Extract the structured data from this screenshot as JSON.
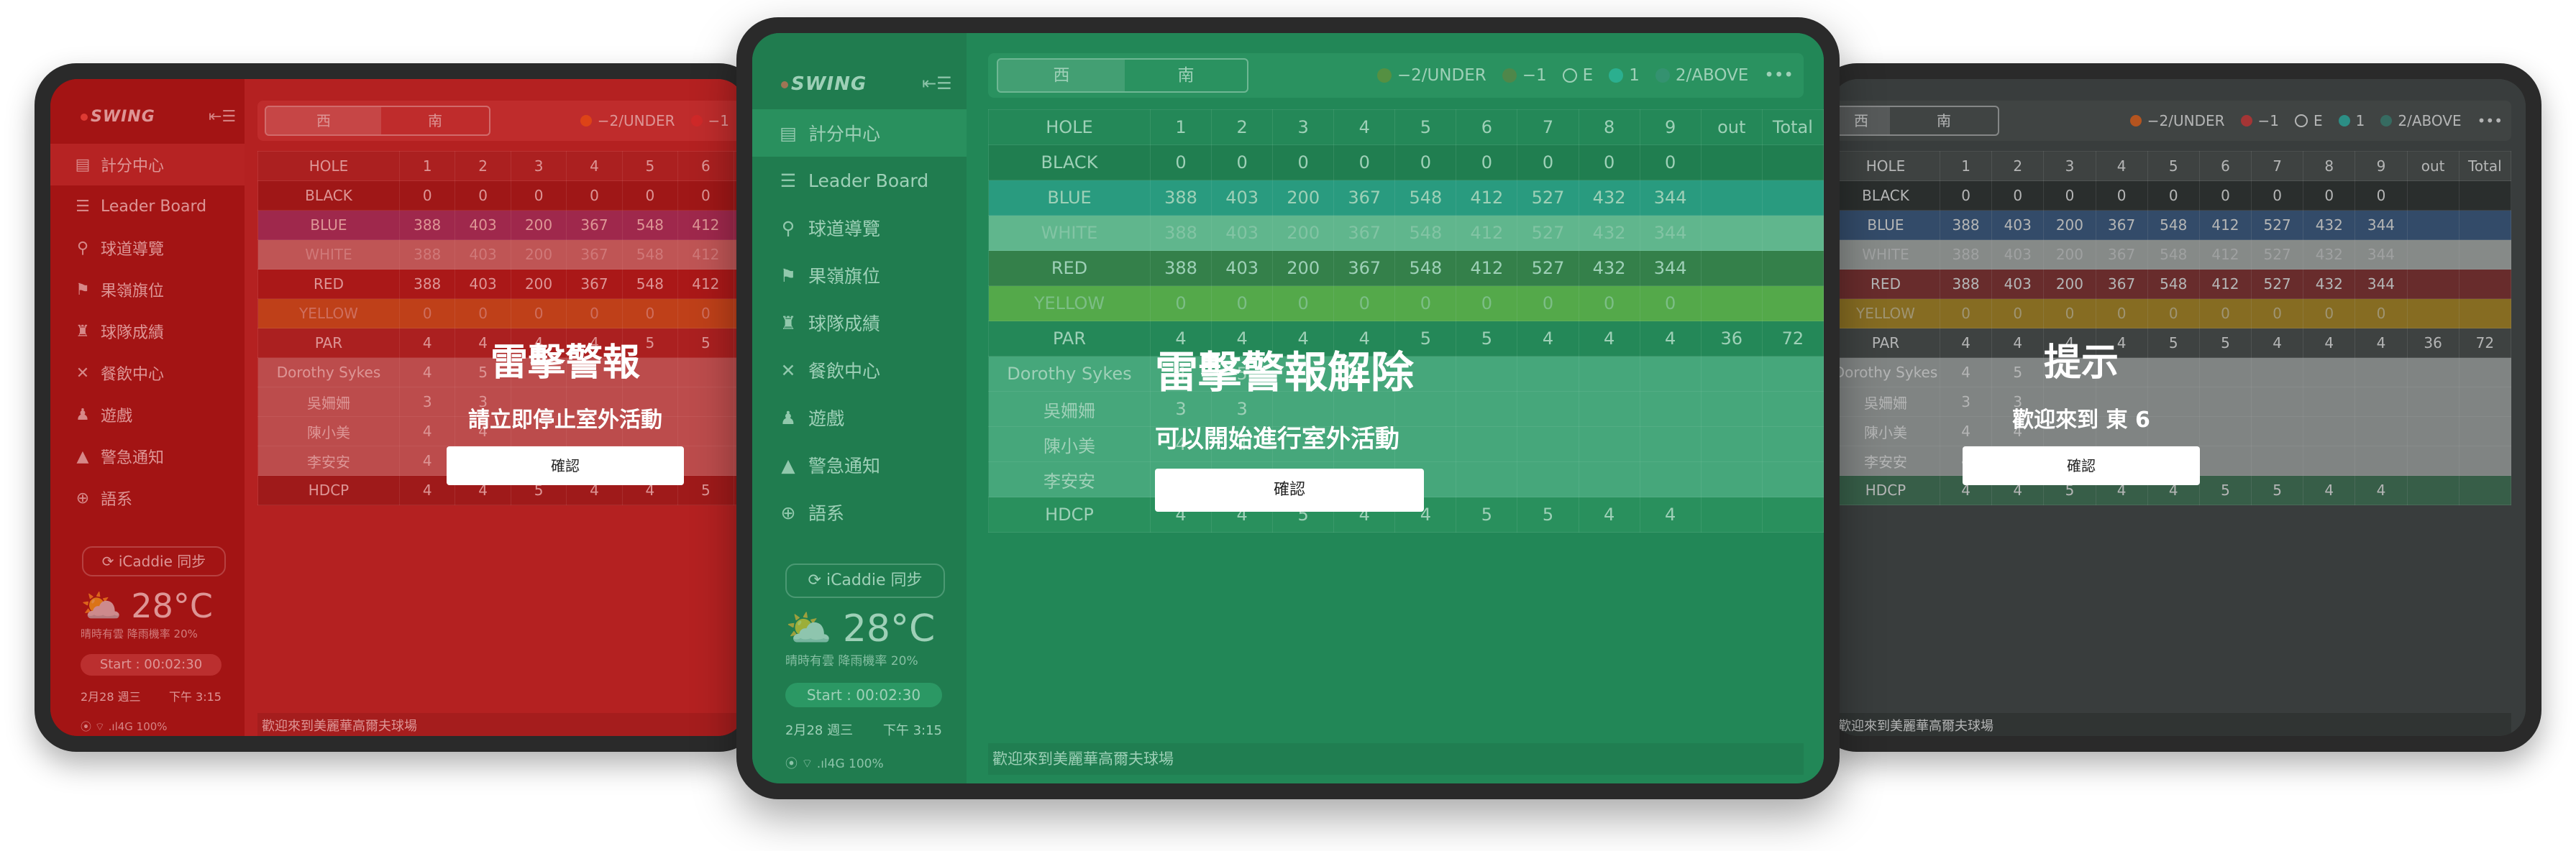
{
  "common": {
    "logo": "SWING",
    "menu": [
      "計分中心",
      "Leader Board",
      "球道導覽",
      "果嶺旗位",
      "球隊成績",
      "餐飲中心",
      "遊戲",
      "警急通知",
      "語系"
    ],
    "icaddie": "iCaddie 同步",
    "temp": "28°C",
    "weather_sub": "晴時有雲  降雨機率 20%",
    "start": "Start : 00:02:30",
    "date": "2月28 週三",
    "time": "下午 3:15",
    "status": "⦿  ⌔ .ıl4G   100%",
    "tabs": [
      "西",
      "南"
    ],
    "legend": [
      "−2/UNDER",
      "−1",
      "E",
      "1",
      "2/ABOVE"
    ],
    "more": "•••",
    "ticker": "歡迎來到美麗華高爾夫球場",
    "header": [
      "HOLE",
      "1",
      "2",
      "3",
      "4",
      "5",
      "6",
      "7",
      "8",
      "9",
      "out",
      "Total"
    ],
    "rows": [
      {
        "label": "BLACK",
        "cells": [
          "0",
          "0",
          "0",
          "0",
          "0",
          "0",
          "0",
          "0",
          "0",
          "",
          ""
        ]
      },
      {
        "label": "BLUE",
        "cells": [
          "388",
          "403",
          "200",
          "367",
          "548",
          "412",
          "527",
          "432",
          "344",
          "",
          ""
        ]
      },
      {
        "label": "WHITE",
        "cells": [
          "388",
          "403",
          "200",
          "367",
          "548",
          "412",
          "527",
          "432",
          "344",
          "",
          ""
        ]
      },
      {
        "label": "RED",
        "cells": [
          "388",
          "403",
          "200",
          "367",
          "548",
          "412",
          "527",
          "432",
          "344",
          "",
          ""
        ]
      },
      {
        "label": "YELLOW",
        "cells": [
          "0",
          "0",
          "0",
          "0",
          "0",
          "0",
          "0",
          "0",
          "0",
          "",
          ""
        ]
      },
      {
        "label": "PAR",
        "cells": [
          "4",
          "4",
          "4",
          "4",
          "5",
          "5",
          "4",
          "4",
          "4",
          "36",
          "72"
        ]
      },
      {
        "label": "Dorothy Sykes",
        "cells": [
          "4",
          "5",
          "",
          "",
          "",
          "",
          "",
          "",
          "",
          "",
          ""
        ]
      },
      {
        "label": "吳姍姍",
        "cells": [
          "3",
          "3",
          "",
          "",
          "",
          "",
          "",
          "",
          "",
          "",
          ""
        ]
      },
      {
        "label": "陳小美",
        "cells": [
          "4",
          "4",
          "",
          "",
          "",
          "",
          "",
          "",
          "",
          "",
          ""
        ]
      },
      {
        "label": "李安安",
        "cells": [
          "4",
          "4",
          "",
          "",
          "",
          "",
          "",
          "",
          "",
          "",
          ""
        ]
      },
      {
        "label": "HDCP",
        "cells": [
          "4",
          "4",
          "5",
          "4",
          "4",
          "5",
          "5",
          "4",
          "4",
          "",
          ""
        ]
      }
    ],
    "confirm": "確認"
  },
  "alerts": {
    "left": {
      "title": "雷擊警報",
      "message": "請立即停止室外活動"
    },
    "center": {
      "title": "雷擊警報解除",
      "message": "可以開始進行室外活動"
    },
    "right": {
      "title": "提示",
      "message": "歡迎來到 東 6"
    }
  },
  "colors": {
    "red_tint": "#b51f1f",
    "green_tint": "#1f7a4e",
    "gray_tint": "#3a3e3d",
    "blue_row": "#2f6fa8",
    "teal_row": "#2fa6a8",
    "white_row": "#b9c0bd",
    "red_row": "#a92e2e",
    "yellow_row": "#d4a017",
    "under": "#ff6b1a",
    "minus1": "#e63b3b",
    "even": "#ffffff",
    "plus1": "#2ec4b6",
    "above": "#3e8e7e",
    "ball_green": "#7b8b2a"
  }
}
